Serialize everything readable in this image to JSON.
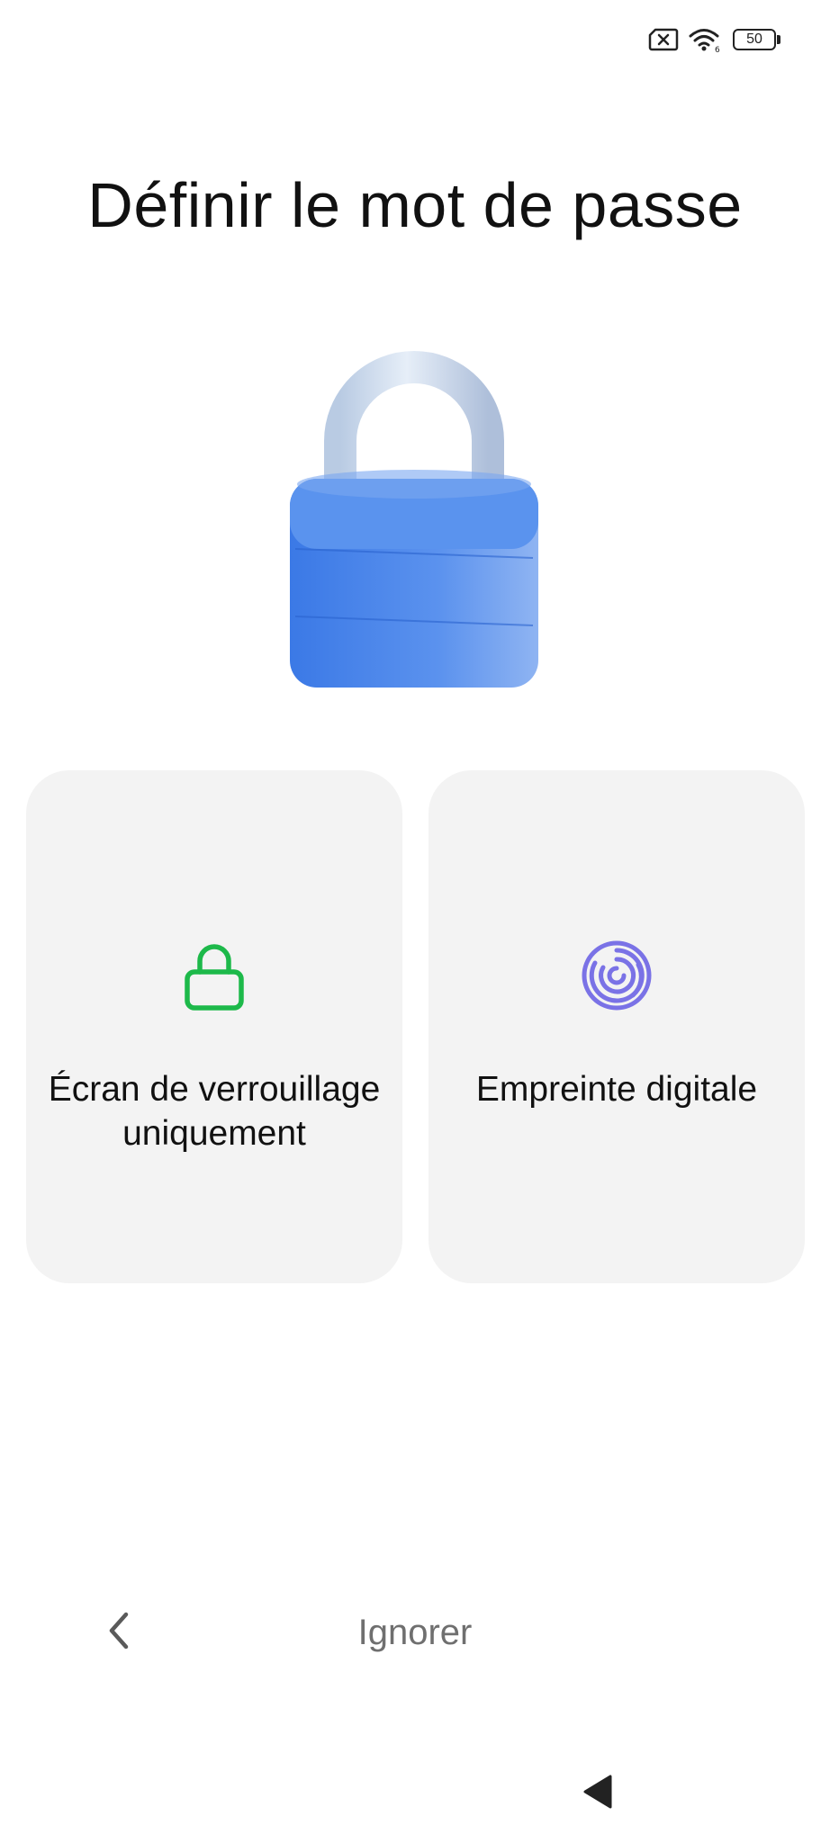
{
  "status_bar": {
    "sim_icon": "no-sim-icon",
    "wifi_icon": "wifi-icon",
    "battery_level": "50"
  },
  "title": "Définir le mot de passe",
  "hero_icon": "padlock-illustration",
  "options": [
    {
      "icon": "lock-icon",
      "icon_color": "#1db94a",
      "label": "Écran de verrouillage uniquement"
    },
    {
      "icon": "fingerprint-icon",
      "icon_color": "#7a72e6",
      "label": "Empreinte digitale"
    }
  ],
  "footer": {
    "back_icon": "chevron-left-icon",
    "skip_label": "Ignorer"
  },
  "system_nav": {
    "back_icon": "triangle-back-icon"
  },
  "colors": {
    "background": "#ffffff",
    "card": "#f3f3f3",
    "padlock_body": "#3f7ae6",
    "padlock_shackle": "#cfdcee"
  }
}
